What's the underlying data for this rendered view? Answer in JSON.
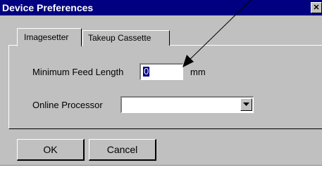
{
  "window": {
    "title": "Device Preferences",
    "close_glyph": "✕"
  },
  "tabs": [
    {
      "label": "Imagesetter",
      "active": true
    },
    {
      "label": "Takeup Cassette",
      "active": false
    }
  ],
  "fields": {
    "min_feed_label": "Minimum Feed Length",
    "min_feed_value": "0",
    "min_feed_unit": "mm",
    "online_processor_label": "Online Processor",
    "online_processor_value": ""
  },
  "buttons": {
    "ok_label": "OK",
    "cancel_label": "Cancel"
  },
  "colors": {
    "titlebar": "#000080",
    "face": "#c0c0c0",
    "callout": "#000000"
  }
}
